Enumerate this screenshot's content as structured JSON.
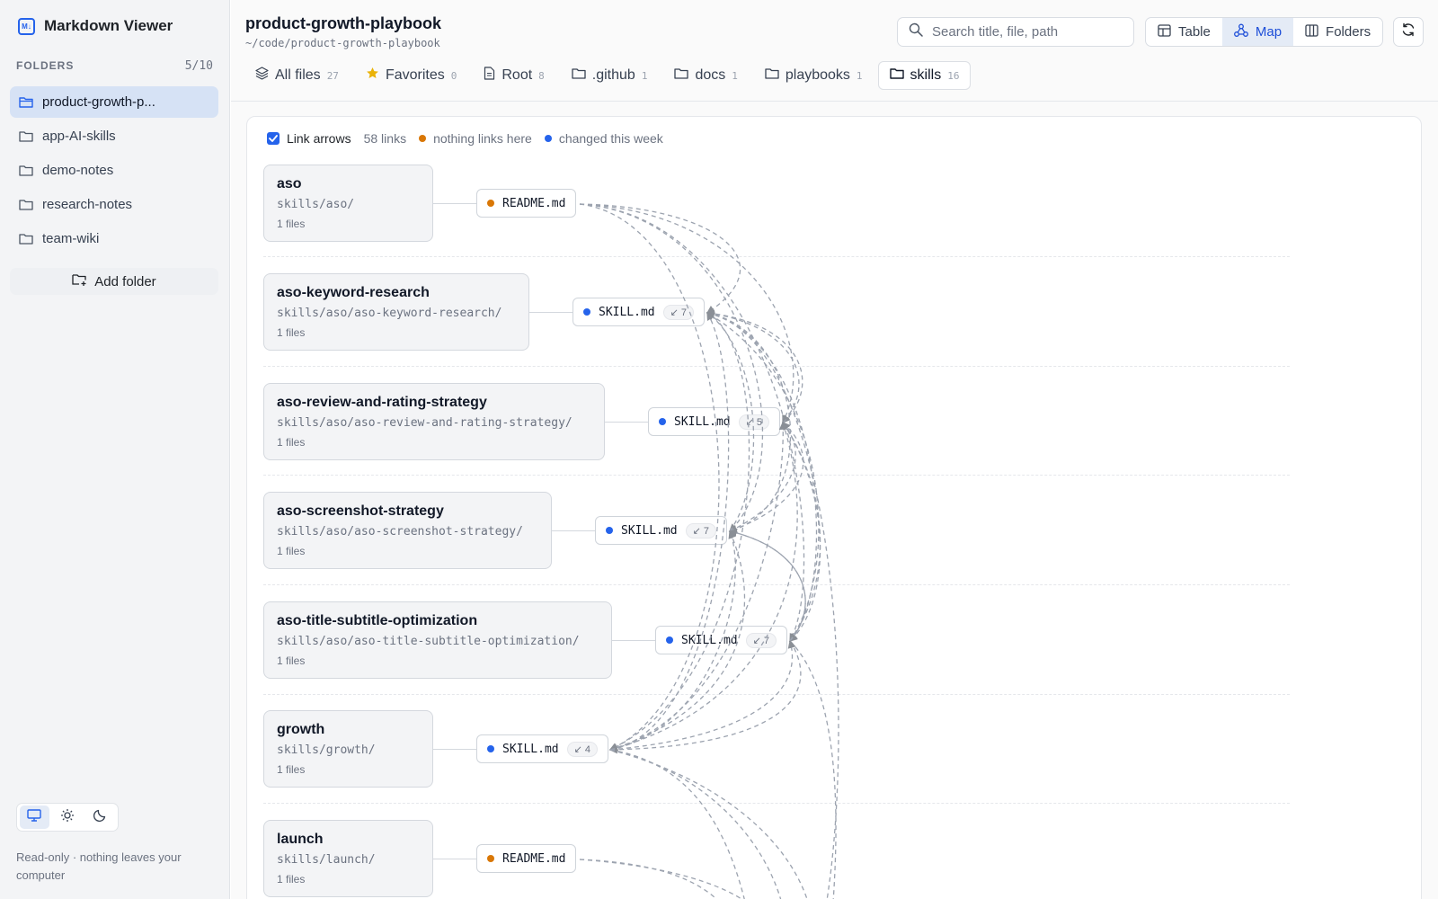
{
  "app": {
    "title": "Markdown Viewer",
    "icon": "markdown-icon"
  },
  "sidebar": {
    "section_label": "FOLDERS",
    "count": "5/10",
    "folders": [
      {
        "label": "product-growth-p...",
        "active": true
      },
      {
        "label": "app-AI-skills",
        "active": false
      },
      {
        "label": "demo-notes",
        "active": false
      },
      {
        "label": "research-notes",
        "active": false
      },
      {
        "label": "team-wiki",
        "active": false
      }
    ],
    "add_folder_label": "Add folder",
    "theme_options": [
      "monitor-icon",
      "sun-icon",
      "moon-icon"
    ],
    "footnote": "Read-only · nothing leaves your computer"
  },
  "header": {
    "title": "product-growth-playbook",
    "path": "~/code/product-growth-playbook",
    "search_placeholder": "Search title, file, path",
    "views": [
      {
        "label": "Table",
        "icon": "table-icon",
        "active": false
      },
      {
        "label": "Map",
        "icon": "map-nodes-icon",
        "active": true
      },
      {
        "label": "Folders",
        "icon": "columns-icon",
        "active": false
      }
    ],
    "tabs": [
      {
        "label": "All files",
        "count": "27",
        "icon": "layers-icon"
      },
      {
        "label": "Favorites",
        "count": "0",
        "icon": "star-icon"
      },
      {
        "label": "Root",
        "count": "8",
        "icon": "file-icon"
      },
      {
        "label": ".github",
        "count": "1",
        "icon": "folder-icon"
      },
      {
        "label": "docs",
        "count": "1",
        "icon": "folder-icon"
      },
      {
        "label": "playbooks",
        "count": "1",
        "icon": "folder-icon"
      },
      {
        "label": "skills",
        "count": "16",
        "icon": "folder-icon",
        "active": true
      }
    ]
  },
  "map": {
    "link_arrows_label": "Link arrows",
    "link_arrows_checked": true,
    "links_count": "58 links",
    "legend": [
      {
        "label": "nothing links here",
        "color": "#d97706"
      },
      {
        "label": "changed this week",
        "color": "#2563eb"
      }
    ],
    "rows": [
      {
        "name": "aso",
        "path": "skills/aso/",
        "files": "1 files",
        "file": "README.md",
        "status": "orphan",
        "backlinks": ""
      },
      {
        "name": "aso-keyword-research",
        "path": "skills/aso/aso-keyword-research/",
        "files": "1 files",
        "file": "SKILL.md",
        "status": "changed",
        "backlinks": "↙ 7"
      },
      {
        "name": "aso-review-and-rating-strategy",
        "path": "skills/aso/aso-review-and-rating-strategy/",
        "files": "1 files",
        "file": "SKILL.md",
        "status": "changed",
        "backlinks": "↙ 5"
      },
      {
        "name": "aso-screenshot-strategy",
        "path": "skills/aso/aso-screenshot-strategy/",
        "files": "1 files",
        "file": "SKILL.md",
        "status": "changed",
        "backlinks": "↙ 7"
      },
      {
        "name": "aso-title-subtitle-optimization",
        "path": "skills/aso/aso-title-subtitle-optimization/",
        "files": "1 files",
        "file": "SKILL.md",
        "status": "changed",
        "backlinks": "↙ 7"
      },
      {
        "name": "growth",
        "path": "skills/growth/",
        "files": "1 files",
        "file": "SKILL.md",
        "status": "changed",
        "backlinks": "↙ 4"
      },
      {
        "name": "launch",
        "path": "skills/launch/",
        "files": "1 files",
        "file": "README.md",
        "status": "orphan",
        "backlinks": ""
      }
    ]
  },
  "colors": {
    "accent": "#2563eb",
    "orphan": "#d97706",
    "changed": "#2563eb"
  }
}
